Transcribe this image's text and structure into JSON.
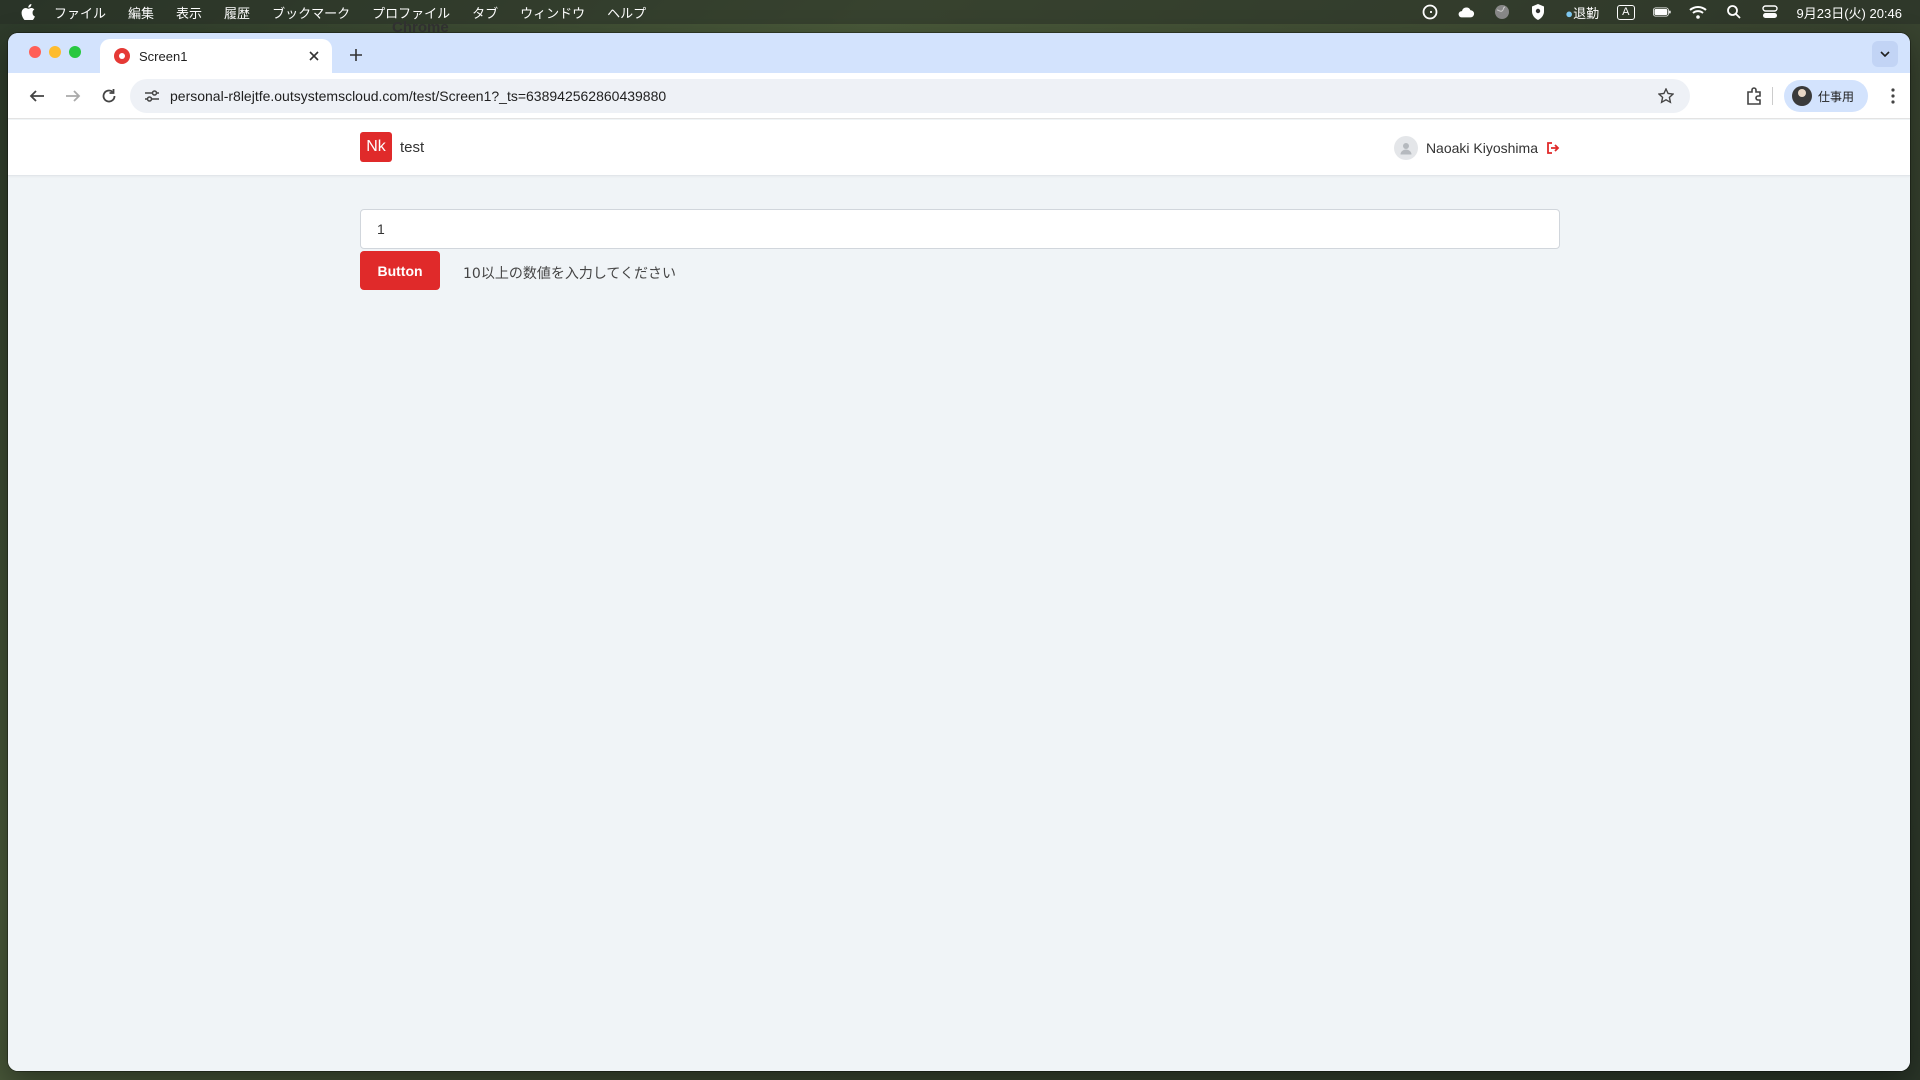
{
  "menubar": {
    "app": "Chrome",
    "items": [
      "ファイル",
      "編集",
      "表示",
      "履歴",
      "ブックマーク",
      "プロファイル",
      "タブ",
      "ウィンドウ",
      "ヘルプ"
    ],
    "status_text": "退勤",
    "input_mode": "A",
    "datetime": "9月23日(火) 20:46"
  },
  "browser": {
    "tab_title": "Screen1",
    "url": "personal-r8lejtfe.outsystemscloud.com/test/Screen1?_ts=638942562860439880",
    "profile_label": "仕事用"
  },
  "app": {
    "logo_text": "Nk",
    "name": "test",
    "user_name": "Naoaki Kiyoshima",
    "input_value": "1",
    "button_label": "Button",
    "message": "10以上の数値を入力してください",
    "accent_color": "#e02a2a"
  }
}
